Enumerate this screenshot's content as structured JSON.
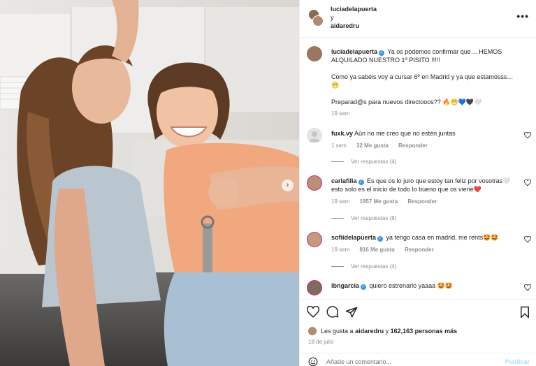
{
  "header": {
    "user": "luciadelapuerta",
    "conj": "y",
    "collaborator": "aidaredru"
  },
  "caption": {
    "user": "luciadelapuerta",
    "line1": "Ya os podemos confirmar que… HEMOS ALQUILADO NUESTRO 1º PISITO !!!!!",
    "line2": "Como ya sabéis voy a cursar 6º en Madrid y ya que estamosss…",
    "line2_emoji": "😁",
    "line3": "Preparad@s para nuevos directooos?? 🔥😁💙🖤🤍",
    "time": "19 sem"
  },
  "comments": [
    {
      "user": "fuxk.vy",
      "verified": false,
      "text": "Aún no me creo que no estén juntas",
      "time": "1 sem",
      "likes": "32 Me gusta",
      "reply": "Responder",
      "replies": "Ver respuestas (4)"
    },
    {
      "user": "carlafilia",
      "verified": true,
      "text": "Es que os lo juro que estoy tan feliz por vosotras🤍 esto solo es el inicio de todo lo bueno que os viene❤️",
      "time": "19 sem",
      "likes": "1957 Me gusta",
      "reply": "Responder",
      "replies": "Ver respuestas (8)"
    },
    {
      "user": "sofiidelapuerta",
      "verified": true,
      "text": "ya tengo casa en madrid, me rents🤩🤩",
      "time": "19 sem",
      "likes": "816 Me gusta",
      "reply": "Responder",
      "replies": "Ver respuestas (4)"
    },
    {
      "user": "ibngarcia",
      "verified": true,
      "text": "quiero estrenarlo yaaaa 🤩🤩",
      "time": "",
      "likes": "",
      "reply": "",
      "replies": ""
    }
  ],
  "footer": {
    "likes_prefix": "Les gusta a",
    "likes_user": "aidaredru",
    "likes_mid": "y",
    "likes_count": "162,163 personas más",
    "date": "18 de julio",
    "comment_placeholder": "Añade un comentario...",
    "post_label": "Publicar"
  },
  "icons": {
    "more": "more-options-icon",
    "heart": "heart-icon",
    "comment": "comment-icon",
    "share": "share-icon",
    "save": "bookmark-icon",
    "emoji": "emoji-icon",
    "next": "chevron-right-icon",
    "verified": "verified-badge-icon"
  },
  "colors": {
    "verified": "#3897f0",
    "muted": "#8e8e8e",
    "publish": "#b2dffc"
  }
}
